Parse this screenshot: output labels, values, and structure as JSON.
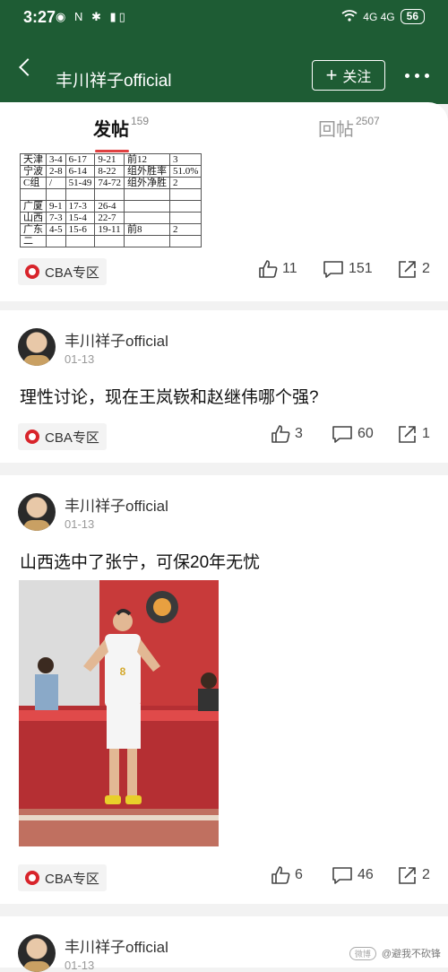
{
  "status_bar": {
    "time": "3:27",
    "left_icons": "◉ N ✱ ▮▯",
    "signal": "4G 4G",
    "battery": "56"
  },
  "header": {
    "title": "丰川祥子official",
    "follow_label": "关注"
  },
  "tabs": [
    {
      "label": "发帖",
      "count": "159"
    },
    {
      "label": "回帖",
      "count": "2507"
    }
  ],
  "stats_table": [
    [
      "天津",
      "3-4",
      "6-17",
      "9-21",
      "前12",
      "3"
    ],
    [
      "宁波",
      "2-8",
      "6-14",
      "8-22",
      "组外胜率",
      "51.0%"
    ],
    [
      "C组",
      "/",
      "51-49",
      "74-72",
      "组外净胜",
      "2"
    ],
    [
      "",
      "",
      "",
      "",
      "",
      ""
    ],
    [
      "广厦",
      "9-1",
      "17-3",
      "26-4",
      "",
      ""
    ],
    [
      "山西",
      "7-3",
      "15-4",
      "22-7",
      "",
      ""
    ],
    [
      "广东",
      "4-5",
      "15-6",
      "19-11",
      "前8",
      "2"
    ],
    [
      "二",
      "",
      "",
      "",
      "",
      ""
    ]
  ],
  "posts": [
    {
      "tag": "CBA专区",
      "likes": "11",
      "comments": "151",
      "shares": "2"
    },
    {
      "author": "丰川祥子official",
      "date": "01-13",
      "text": "理性讨论，现在王岚嵚和赵继伟哪个强?",
      "tag": "CBA专区",
      "likes": "3",
      "comments": "60",
      "shares": "1"
    },
    {
      "author": "丰川祥子official",
      "date": "01-13",
      "text": "山西选中了张宁，可保20年无忧",
      "tag": "CBA专区",
      "likes": "6",
      "comments": "46",
      "shares": "2"
    },
    {
      "author": "丰川祥子official",
      "date": "01-13"
    }
  ],
  "watermark": {
    "badge": "微博",
    "text": "@避我不砍锋"
  },
  "colors": {
    "header_bg": "#1e5c34",
    "tab_accent": "#e04040",
    "tag_logo": "#d8242b"
  }
}
